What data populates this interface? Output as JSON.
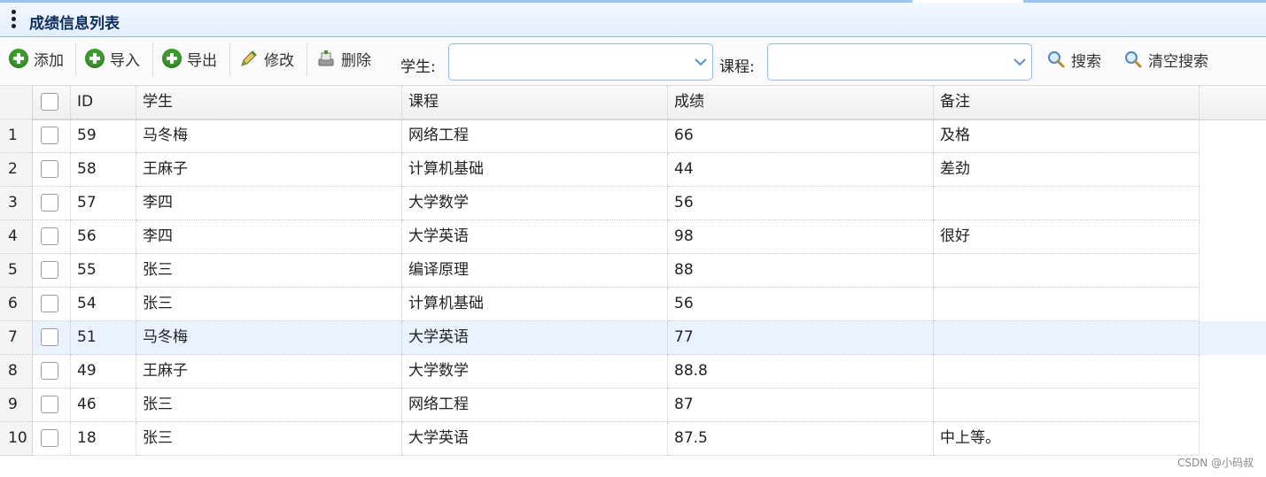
{
  "panel": {
    "title": "成绩信息列表"
  },
  "toolbar": {
    "add_label": "添加",
    "import_label": "导入",
    "export_label": "导出",
    "edit_label": "修改",
    "delete_label": "删除",
    "student_label": "学生:",
    "student_value": "",
    "course_label": "课程:",
    "course_value": "",
    "search_label": "搜索",
    "clear_search_label": "清空搜索"
  },
  "table": {
    "columns": [
      "ID",
      "学生",
      "课程",
      "成绩",
      "备注"
    ],
    "rows": [
      {
        "num": "1",
        "id": "59",
        "student": "马冬梅",
        "course": "网络工程",
        "score": "66",
        "note": "及格"
      },
      {
        "num": "2",
        "id": "58",
        "student": "王麻子",
        "course": "计算机基础",
        "score": "44",
        "note": "差劲"
      },
      {
        "num": "3",
        "id": "57",
        "student": "李四",
        "course": "大学数学",
        "score": "56",
        "note": ""
      },
      {
        "num": "4",
        "id": "56",
        "student": "李四",
        "course": "大学英语",
        "score": "98",
        "note": "很好"
      },
      {
        "num": "5",
        "id": "55",
        "student": "张三",
        "course": "编译原理",
        "score": "88",
        "note": ""
      },
      {
        "num": "6",
        "id": "54",
        "student": "张三",
        "course": "计算机基础",
        "score": "56",
        "note": ""
      },
      {
        "num": "7",
        "id": "51",
        "student": "马冬梅",
        "course": "大学英语",
        "score": "77",
        "note": ""
      },
      {
        "num": "8",
        "id": "49",
        "student": "王麻子",
        "course": "大学数学",
        "score": "88.8",
        "note": ""
      },
      {
        "num": "9",
        "id": "46",
        "student": "张三",
        "course": "网络工程",
        "score": "87",
        "note": ""
      },
      {
        "num": "10",
        "id": "18",
        "student": "张三",
        "course": "大学英语",
        "score": "87.5",
        "note": "中上等。"
      }
    ]
  },
  "watermark": "CSDN @小码叔",
  "colors": {
    "accent": "#95b8e7",
    "title_text": "#0e2d5f",
    "add_icon": "#3c9a2c",
    "row_highlight": "#eaf2ff"
  },
  "icons": [
    "menu-dots-icon",
    "plus-icon",
    "pencil-icon",
    "delete-icon",
    "chevron-down-icon",
    "magnifier-icon"
  ]
}
